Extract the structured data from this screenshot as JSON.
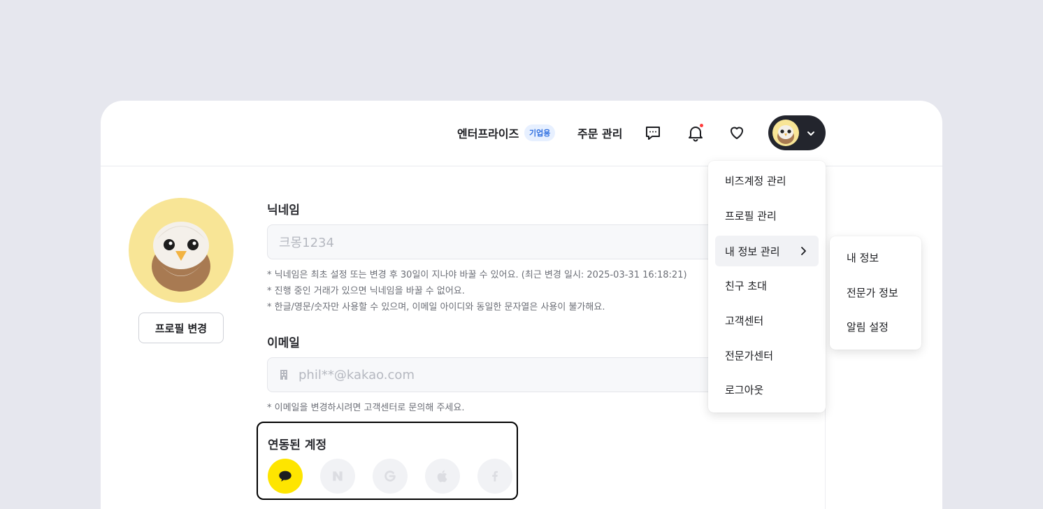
{
  "header": {
    "enterprise_label": "엔터프라이즈",
    "enterprise_badge": "기업용",
    "orders_label": "주문 관리"
  },
  "profile": {
    "change_button": "프로필 변경"
  },
  "nickname": {
    "label": "닉네임",
    "placeholder": "크몽1234",
    "hints": [
      "* 닉네임은 최초 설정 또는 변경 후 30일이 지나야 바꿀 수 있어요. (최근 변경 일시: 2025-03-31 16:18:21)",
      "* 진행 중인 거래가 있으면 닉네임을 바꿀 수 없어요.",
      "* 한글/영문/숫자만 사용할 수 있으며, 이메일 아이디와 동일한 문자열은 사용이 불가해요."
    ]
  },
  "email": {
    "label": "이메일",
    "value": "phil**@kakao.com",
    "hint": "* 이메일을 변경하시려면 고객센터로 문의해 주세요."
  },
  "linked_accounts": {
    "label": "연동된 계정",
    "providers": [
      "kakao",
      "naver",
      "google",
      "apple",
      "facebook"
    ]
  },
  "menu": {
    "items": [
      "비즈계정 관리",
      "프로필 관리",
      "내 정보 관리",
      "친구 초대",
      "고객센터",
      "전문가센터",
      "로그아웃"
    ],
    "active_index": 2
  },
  "submenu": {
    "items": [
      "내 정보",
      "전문가 정보",
      "알림 설정"
    ]
  },
  "colors": {
    "kakao": "#fee500",
    "badge_bg": "#e7f0ff",
    "badge_text": "#2f6fe0",
    "notification": "#ff3b3b",
    "toggle_bg": "#23252d"
  }
}
